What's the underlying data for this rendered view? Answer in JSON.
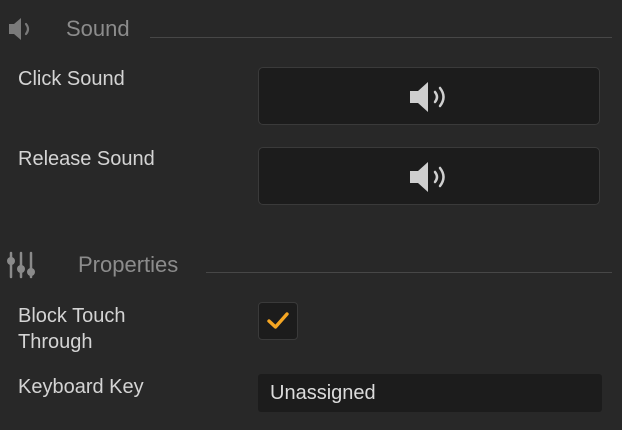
{
  "sound_section": {
    "title": "Sound",
    "icon": "speaker-icon",
    "click_label": "Click Sound",
    "release_label": "Release Sound"
  },
  "properties_section": {
    "title": "Properties",
    "icon": "sliders-icon",
    "block_touch_label_line1": "Block Touch",
    "block_touch_label_line2": "Through",
    "block_touch_checked": true,
    "keyboard_key_label": "Keyboard Key",
    "keyboard_key_value": "Unassigned"
  },
  "colors": {
    "background": "#282828",
    "field": "#1c1c1c",
    "check_accent": "#f5a623"
  }
}
